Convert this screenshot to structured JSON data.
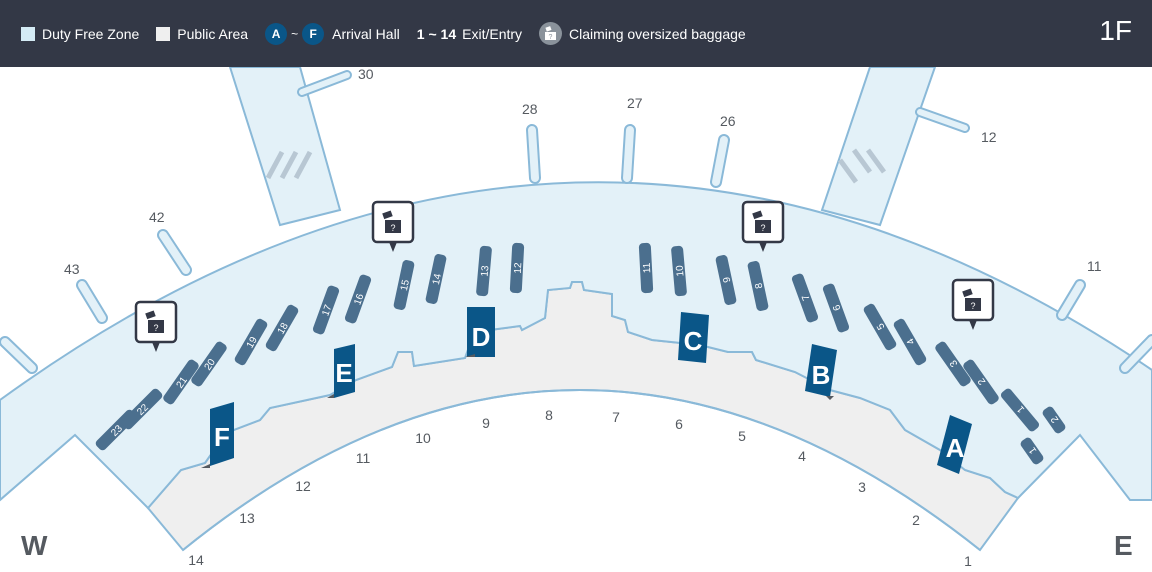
{
  "header": {
    "floor": "1F",
    "legend": {
      "duty_free": "Duty Free Zone",
      "public": "Public Area",
      "hall_from": "A",
      "hall_sep": "~",
      "hall_to": "F",
      "hall_label": "Arrival Hall",
      "exit_range": "1 ~ 14",
      "exit_label": "Exit/Entry",
      "baggage_label": "Claiming oversized baggage"
    }
  },
  "compass": {
    "west": "W",
    "east": "E"
  },
  "colors": {
    "header_bg": "#333846",
    "duty_free": "#e3f1f8",
    "public": "#efefef",
    "outline": "#8ab9d8",
    "carousel": "#4b6f8e",
    "arrival_hall": "#0a5688",
    "label": "#555a60"
  },
  "gates": [
    "43",
    "42",
    "30",
    "28",
    "27",
    "26",
    "12",
    "11"
  ],
  "carousels": [
    "23",
    "22",
    "21",
    "20",
    "19",
    "18",
    "17",
    "16",
    "15",
    "14",
    "13",
    "12",
    "11",
    "10",
    "9",
    "8",
    "7",
    "6",
    "5",
    "4",
    "3",
    "2",
    "1",
    "2",
    "1"
  ],
  "arrival_halls": [
    "F",
    "E",
    "D",
    "C",
    "B",
    "A"
  ],
  "exits": [
    "14",
    "13",
    "12",
    "11",
    "10",
    "9",
    "8",
    "7",
    "6",
    "5",
    "4",
    "3",
    "2",
    "1"
  ],
  "baggage_icons": [
    "baggage-claim",
    "baggage-claim",
    "baggage-claim",
    "baggage-claim"
  ]
}
